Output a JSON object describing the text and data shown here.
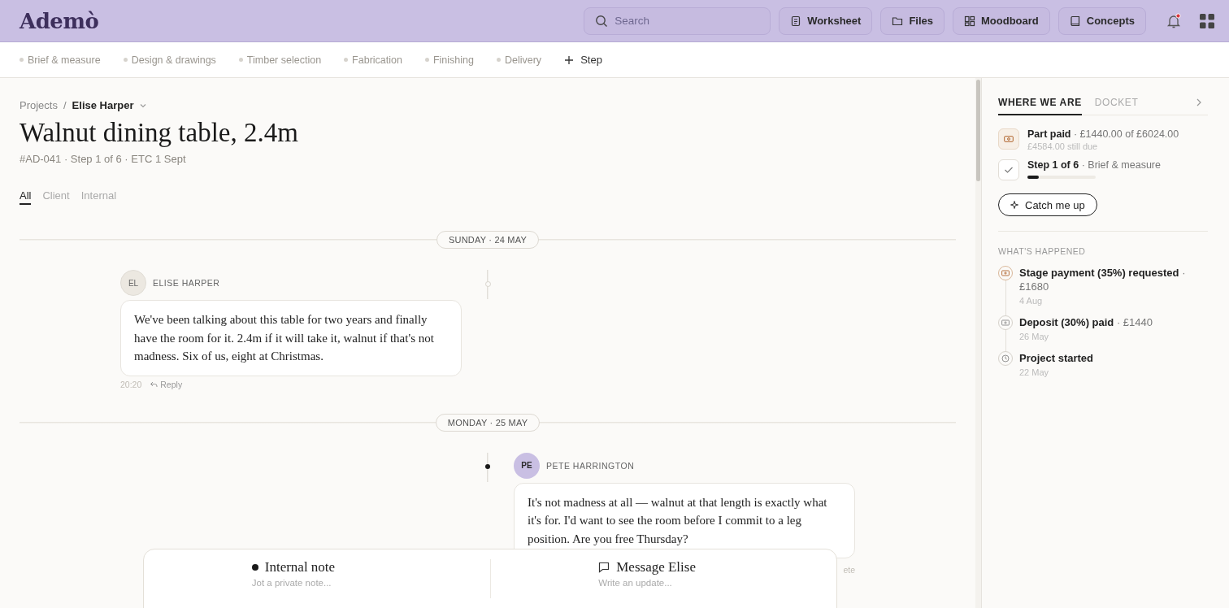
{
  "header": {
    "logo": "Ademò",
    "search": {
      "placeholder": "Search"
    },
    "buttons": [
      {
        "label": "Worksheet",
        "kind": "clipboard"
      },
      {
        "label": "Files",
        "kind": "folder"
      },
      {
        "label": "Moodboard",
        "kind": "grid"
      },
      {
        "label": "Concepts",
        "kind": "book"
      }
    ],
    "notifications": {
      "unread": true
    }
  },
  "steps": {
    "items": [
      "Brief & measure",
      "Design & drawings",
      "Timber selection",
      "Fabrication",
      "Finishing",
      "Delivery"
    ],
    "add_label": "Step"
  },
  "breadcrumb": {
    "root": "Projects",
    "separator": "/",
    "current": "Elise Harper"
  },
  "title": "Walnut dining table, 2.4m",
  "meta": "#AD-041 · Step 1 of 6 · ETC 1 Sept",
  "filters": [
    {
      "label": "All",
      "selected": true
    },
    {
      "label": "Client",
      "selected": false
    },
    {
      "label": "Internal",
      "selected": false
    }
  ],
  "timeline": [
    {
      "kind": "date",
      "label": "SUNDAY · 24 MAY"
    },
    {
      "kind": "message",
      "from_client": true,
      "initials": "EL",
      "author": "ELISE HARPER",
      "text": "We've been talking about this table for two years and finally have the room for it. 2.4m if it will take it, walnut if that's not madness. Six of us, eight at Christmas.",
      "time": "20:20",
      "reply": "Reply"
    },
    {
      "kind": "date",
      "label": "MONDAY · 25 MAY"
    },
    {
      "kind": "message",
      "from_client": false,
      "initials": "PE",
      "author": "PETE HARRINGTON",
      "text": "It's not madness at all — walnut at that length is exactly what it's for. I'd want to see the room before I commit to a leg position. Are you free Thursday?",
      "time": "ete"
    }
  ],
  "composer": [
    {
      "kind": "note",
      "label": "Internal note",
      "placeholder": "Jot a private note..."
    },
    {
      "kind": "message",
      "label": "Message Elise",
      "placeholder": "Write an update..."
    }
  ],
  "panel": {
    "tabs": [
      {
        "label": "WHERE WE ARE",
        "selected": true
      },
      {
        "label": "DOCKET",
        "selected": false
      }
    ],
    "status": [
      {
        "kind": "payment",
        "text": "**Part paid** · £1440.00 of £6024.00",
        "sub": "£4584.00 still due"
      },
      {
        "kind": "step",
        "text": "**Step 1 of 6** · Brief & measure",
        "level": 0.17
      }
    ],
    "catch_up": "Catch me up",
    "history_title": "WHAT'S HAPPENED",
    "events": [
      {
        "kind": "payment_requested",
        "text": "**Stage payment (35%) requested** · £1680",
        "date": "4 Aug"
      },
      {
        "kind": "payment_paid",
        "text": "**Deposit (30%) paid** · £1440",
        "date": "26 May"
      },
      {
        "kind": "started",
        "text": "**Project started**",
        "date": "22 May"
      }
    ]
  }
}
